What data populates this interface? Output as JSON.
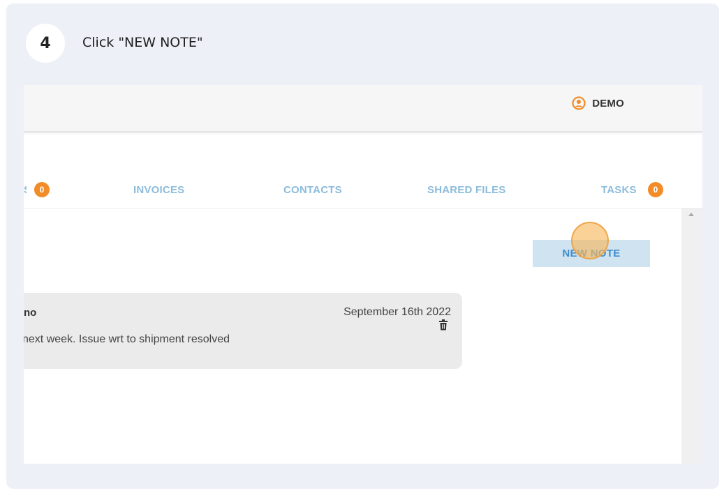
{
  "step": {
    "number": "4",
    "instruction": "Click \"NEW NOTE\""
  },
  "header": {
    "user_name": "DEMO",
    "user_icon": "user-circle-icon",
    "accent_color": "#f28c28"
  },
  "tabs": [
    {
      "label": "INVOICES"
    },
    {
      "label": "CONTACTS"
    },
    {
      "label": "SHARED FILES"
    },
    {
      "label": "TASKS",
      "badge": "0"
    }
  ],
  "partial_tab_badge": "0",
  "notes": {
    "new_note_label": "NEW NOTE",
    "items": [
      {
        "author": "no",
        "date": "September 16th 2022",
        "text": "l next week. Issue wrt to shipment resolved",
        "delete_icon": "trash-icon"
      }
    ]
  }
}
